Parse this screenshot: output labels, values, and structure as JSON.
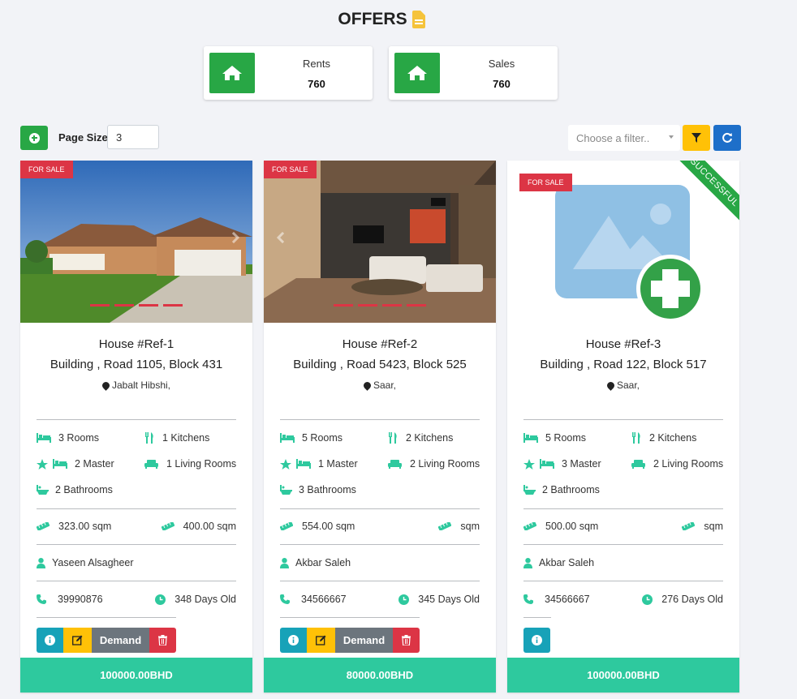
{
  "page": {
    "title": "OFFERS"
  },
  "stats": [
    {
      "label": "Rents",
      "value": "760"
    },
    {
      "label": "Sales",
      "value": "760"
    }
  ],
  "toolbar": {
    "page_size_label": "Page Size",
    "page_size_value": "3",
    "filter_placeholder": "Choose a filter.."
  },
  "colors": {
    "green": "#28a745",
    "teal": "#2ec99e",
    "red": "#dc3545",
    "yellow": "#ffc107",
    "blue": "#1e6fc9",
    "gray": "#6c757d",
    "cyan": "#17a2b8"
  },
  "cards": [
    {
      "tag": "FOR SALE",
      "title": "House #Ref-1",
      "address": "Building , Road 1105, Block 431",
      "location": "Jabalt Hibshi,",
      "rooms": "3 Rooms",
      "kitchens": "1 Kitchens",
      "master": "2 Master",
      "living": "1 Living Rooms",
      "bathrooms": "2 Bathrooms",
      "area1": "323.00 sqm",
      "area2": "400.00 sqm",
      "agent": "Yaseen Alsagheer",
      "phone": "39990876",
      "age": "348 Days Old",
      "demand_label": "Demand",
      "price": "100000.00BHD"
    },
    {
      "tag": "FOR SALE",
      "title": "House #Ref-2",
      "address": "Building , Road 5423, Block 525",
      "location": "Saar,",
      "rooms": "5 Rooms",
      "kitchens": "2 Kitchens",
      "master": "1 Master",
      "living": "2 Living Rooms",
      "bathrooms": "3 Bathrooms",
      "area1": "554.00 sqm",
      "area2": "sqm",
      "agent": "Akbar Saleh",
      "phone": "34566667",
      "age": "345 Days Old",
      "demand_label": "Demand",
      "price": "80000.00BHD"
    },
    {
      "tag": "FOR SALE",
      "ribbon": "SUCCESSFUL",
      "title": "House #Ref-3",
      "address": "Building , Road 122, Block 517",
      "location": "Saar,",
      "rooms": "5 Rooms",
      "kitchens": "2 Kitchens",
      "master": "3 Master",
      "living": "2 Living Rooms",
      "bathrooms": "2 Bathrooms",
      "area1": "500.00 sqm",
      "area2": "sqm",
      "agent": "Akbar Saleh",
      "phone": "34566667",
      "age": "276 Days Old",
      "price": "100000.00BHD"
    }
  ]
}
